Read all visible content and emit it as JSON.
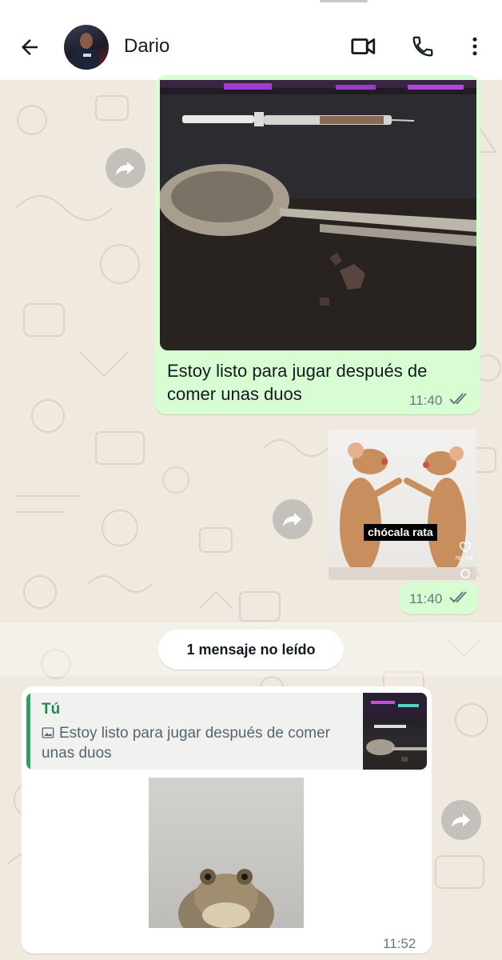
{
  "header": {
    "contact_name": "Dario",
    "back_icon": "arrow-left-icon",
    "video_icon": "video-call-icon",
    "call_icon": "phone-icon",
    "menu_icon": "more-vertical-icon"
  },
  "messages": [
    {
      "direction": "outgoing",
      "type": "image",
      "text": "Estoy listo para jugar después de comer unas duos",
      "time": "11:40",
      "status": "read"
    },
    {
      "direction": "outgoing",
      "type": "sticker",
      "caption": "chócala rata",
      "likes": "781 mil",
      "time": "11:40",
      "status": "read"
    },
    {
      "direction": "incoming",
      "type": "image-reply",
      "quote": {
        "author": "Tú",
        "text": "Estoy listo para jugar después de comer unas duos"
      },
      "time": "11:52"
    }
  ],
  "unread_banner": "1 mensaje no leído",
  "colors": {
    "outgoing_bubble": "#d9fdd3",
    "incoming_bubble": "#ffffff",
    "chat_background": "#efe9df",
    "read_ticks": "#667781",
    "quote_accent": "#25a55f"
  }
}
